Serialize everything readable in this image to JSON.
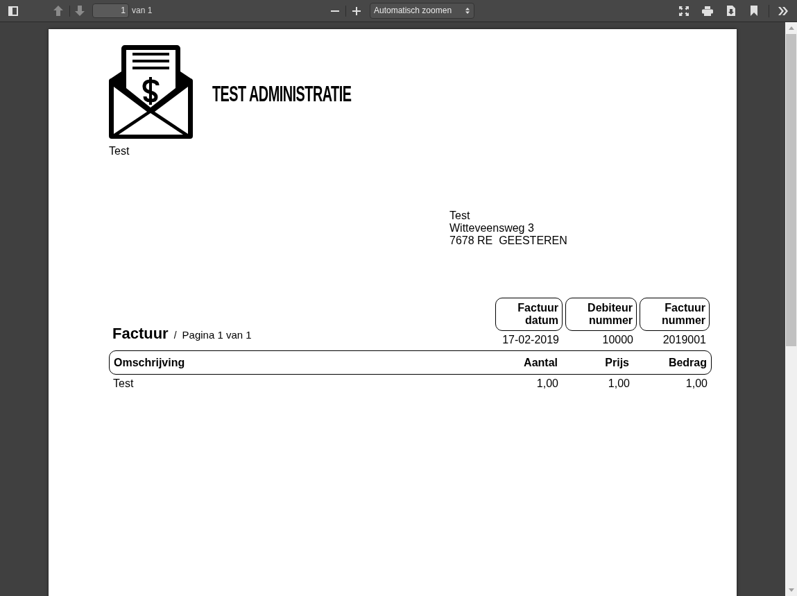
{
  "toolbar": {
    "page_number": "1",
    "page_count": "van 1",
    "zoom": "Automatisch zoomen"
  },
  "document": {
    "company": "TEST ADMINISTRATIE",
    "sender": "Test",
    "address": [
      "Test",
      "Witteveensweg 3",
      "7678 RE  GEESTEREN"
    ],
    "info_columns": [
      {
        "heading": [
          "Factuur",
          "datum"
        ],
        "value": "17-02-2019"
      },
      {
        "heading": [
          "Debiteur",
          "nummer"
        ],
        "value": "10000"
      },
      {
        "heading": [
          "Factuur",
          "nummer"
        ],
        "value": "2019001"
      }
    ],
    "title": "Factuur",
    "separator": "/",
    "page_label": "Pagina 1 van 1",
    "table": {
      "columns": [
        "Omschrijving",
        "Aantal",
        "Prijs",
        "Bedrag"
      ],
      "rows": [
        [
          "Test",
          "1,00",
          "1,00",
          "1,00"
        ]
      ]
    }
  }
}
